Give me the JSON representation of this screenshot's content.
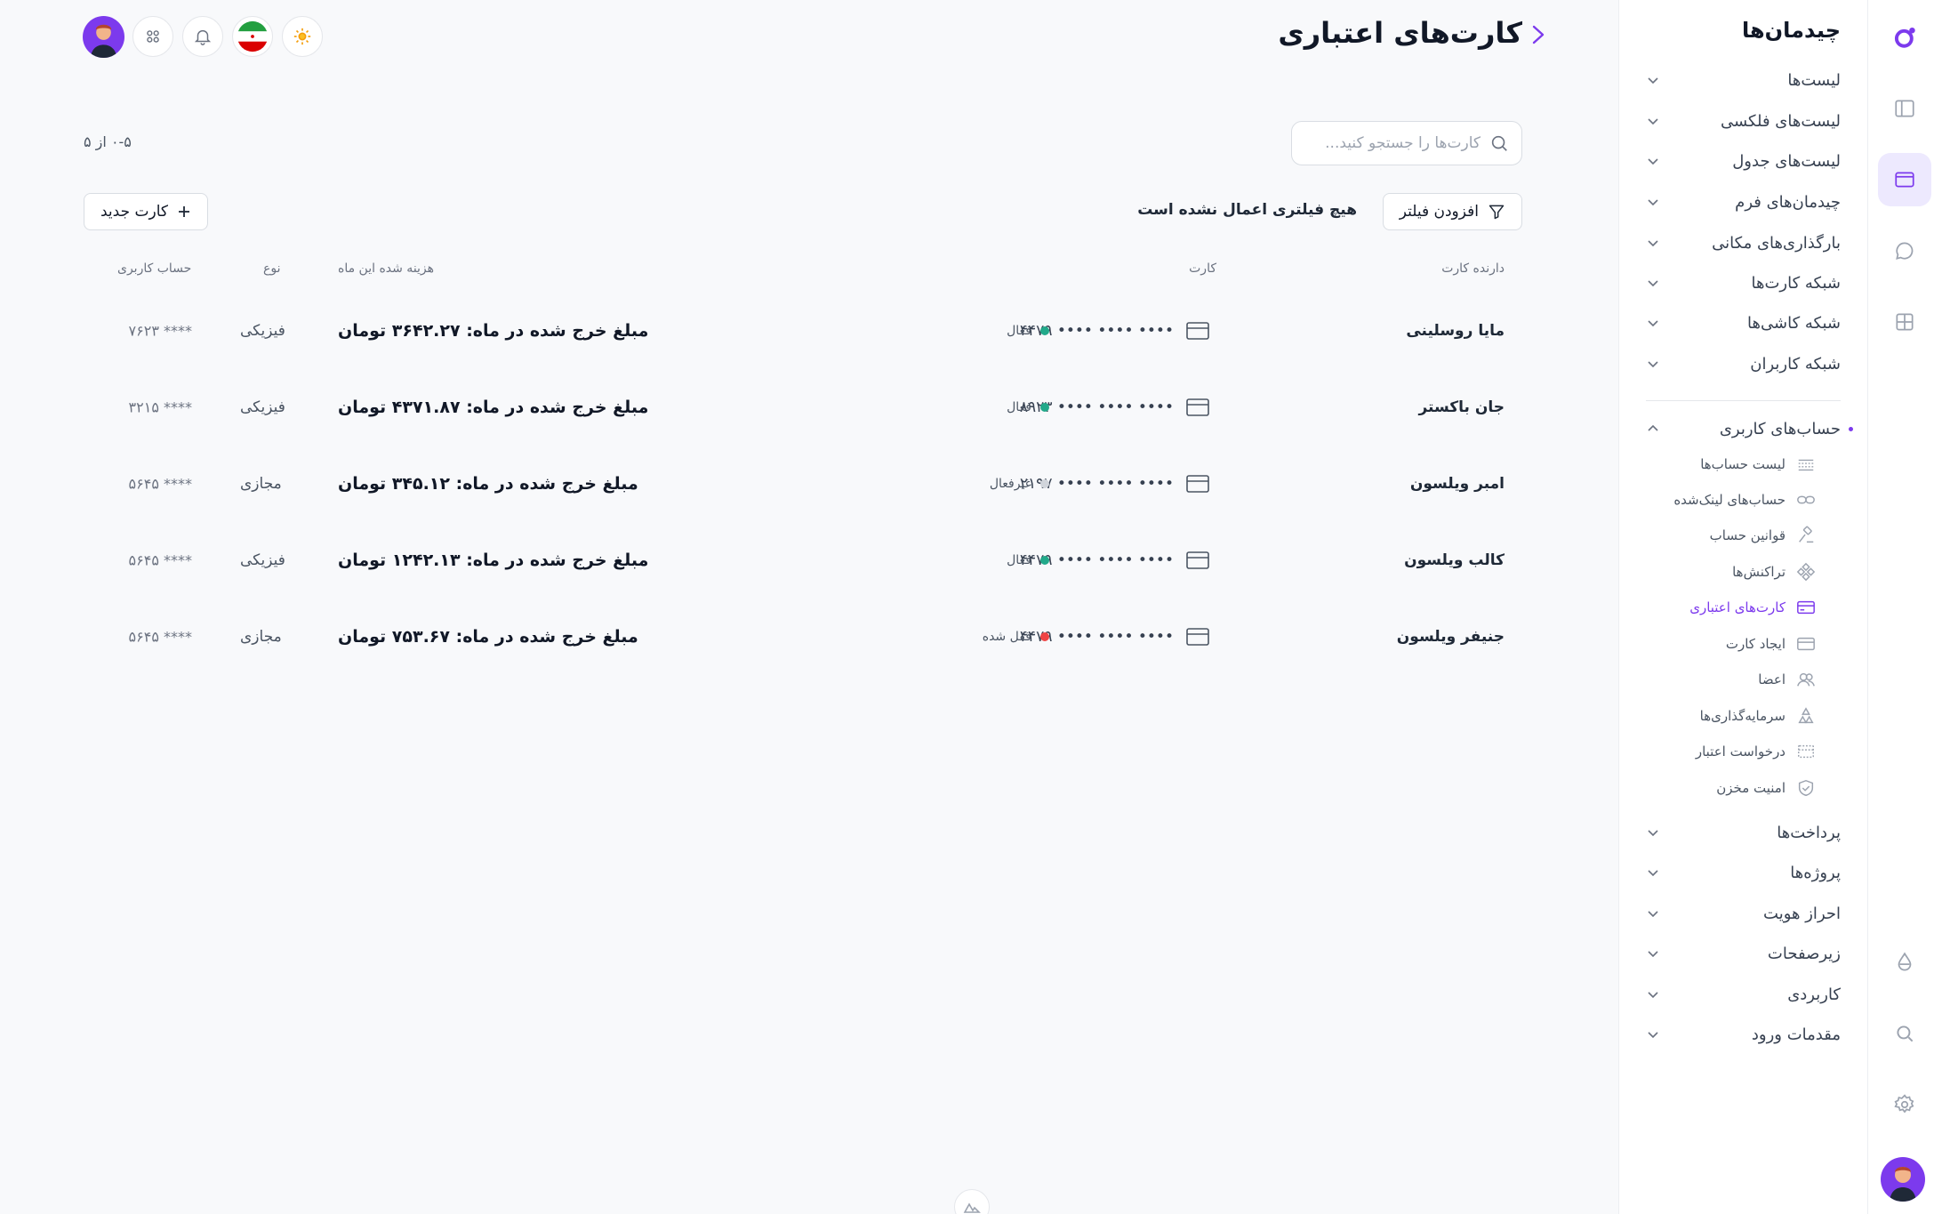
{
  "sidebar": {
    "title": "چیدمان‌ها",
    "items": [
      {
        "label": "لیست‌ها"
      },
      {
        "label": "لیست‌های فلکسی"
      },
      {
        "label": "لیست‌های جدول"
      },
      {
        "label": "چیدمان‌های فرم"
      },
      {
        "label": "بارگذاری‌های مکانی"
      },
      {
        "label": "شبکه کارت‌ها"
      },
      {
        "label": "شبکه کاشی‌ها"
      },
      {
        "label": "شبکه کاربران"
      }
    ],
    "group": {
      "label": "حساب‌های کاربری",
      "subitems": [
        {
          "label": "لیست حساب‌ها",
          "icon": "list-icon"
        },
        {
          "label": "حساب‌های لینک‌شده",
          "icon": "link-icon"
        },
        {
          "label": "قوانین حساب",
          "icon": "gavel-icon"
        },
        {
          "label": "تراکنش‌ها",
          "icon": "transactions-icon"
        },
        {
          "label": "کارت‌های اعتباری",
          "icon": "credit-card-icon",
          "active": true
        },
        {
          "label": "ایجاد کارت",
          "icon": "create-card-icon"
        },
        {
          "label": "اعضا",
          "icon": "members-icon"
        },
        {
          "label": "سرمایه‌گذاری‌ها",
          "icon": "investments-icon"
        },
        {
          "label": "درخواست اعتبار",
          "icon": "credit-request-icon"
        },
        {
          "label": "امنیت مخزن",
          "icon": "shield-icon"
        }
      ]
    },
    "bottom_items": [
      {
        "label": "پرداخت‌ها"
      },
      {
        "label": "پروژه‌ها"
      },
      {
        "label": "احراز هویت"
      },
      {
        "label": "زیرصفحات"
      },
      {
        "label": "کاربردی"
      },
      {
        "label": "مقدمات ورود"
      }
    ]
  },
  "header": {
    "title": "کارت‌های اعتباری"
  },
  "search": {
    "placeholder": "کارت‌ها را جستجو کنید..."
  },
  "pager": "۰-۵ از ۵",
  "toolbar": {
    "filter_label": "افزودن فیلتر",
    "filter_note": "هیچ فیلتری اعمال نشده است",
    "new_card_label": "کارت جدید"
  },
  "table": {
    "columns": {
      "holder": "دارنده کارت",
      "card": "کارت",
      "spent": "هزینه شده این ماه",
      "type": "نوع",
      "account": "حساب کاربری"
    },
    "rows": [
      {
        "holder": "مایا روسلینی",
        "card": "۴۴۷۹ •••• •••• ••••",
        "status": "فعال",
        "status_color": "#22a98a",
        "spent": "مبلغ خرج شده در ماه: ۳۶۴۲.۲۷ تومان",
        "type": "فیزیکی",
        "account": "۷۶۲۳ ****"
      },
      {
        "holder": "جان باکستر",
        "card": "۸۹۲۳ •••• •••• ••••",
        "status": "فعال",
        "status_color": "#22a98a",
        "spent": "مبلغ خرج شده در ماه: ۴۳۷۱.۸۷ تومان",
        "type": "فیزیکی",
        "account": "۳۲۱۵ ****"
      },
      {
        "holder": "امبر ویلسون",
        "card": "۲۱۹۷ •••• •••• ••••",
        "status": "غیرفعال",
        "status_color": "#d1d5db",
        "spent": "مبلغ خرج شده در ماه: ۳۴۵.۱۲ تومان",
        "type": "مجازی",
        "account": "۵۶۴۵ ****"
      },
      {
        "holder": "کالب ویلسون",
        "card": "۴۴۷۹ •••• •••• ••••",
        "status": "فعال",
        "status_color": "#22a98a",
        "spent": "مبلغ خرج شده در ماه: ۱۲۴۲.۱۳ تومان",
        "type": "فیزیکی",
        "account": "۵۶۴۵ ****"
      },
      {
        "holder": "جنیفر ویلسون",
        "card": "۴۴۷۹ •••• •••• ••••",
        "status": "قفل شده",
        "status_color": "#ef4444",
        "spent": "مبلغ خرج شده در ماه: ۷۵۳.۶۷ تومان",
        "type": "مجازی",
        "account": "۵۶۴۵ ****"
      }
    ]
  },
  "colors": {
    "accent": "#7c3aed",
    "accent_bg": "#ede9fe",
    "active": "#22a98a",
    "locked": "#ef4444"
  }
}
